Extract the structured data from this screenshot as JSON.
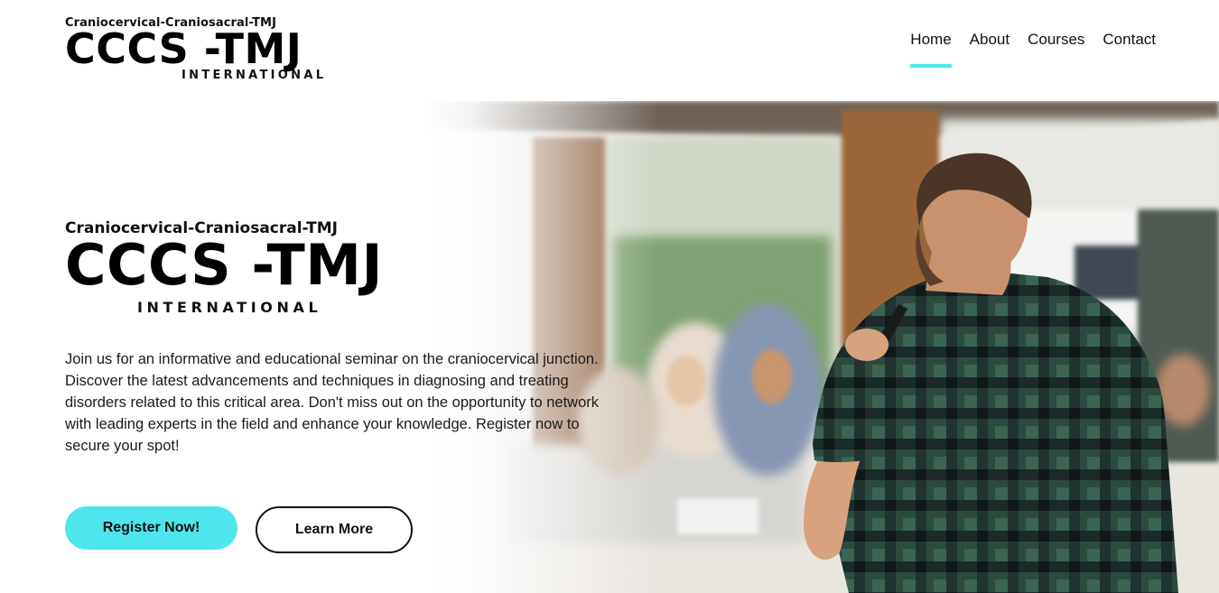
{
  "logo": {
    "subtitle": "Craniocervical-Craniosacral-TMJ",
    "title": "CCCS -TMJ",
    "tagline": "INTERNATIONAL"
  },
  "nav": {
    "items": [
      {
        "label": "Home",
        "active": true
      },
      {
        "label": "About",
        "active": false
      },
      {
        "label": "Courses",
        "active": false
      },
      {
        "label": "Contact",
        "active": false
      }
    ]
  },
  "hero": {
    "subtitle": "Craniocervical-Craniosacral-TMJ",
    "title": "CCCS -TMJ",
    "tagline": "INTERNATIONAL",
    "description": "Join us for an informative and educational seminar on the craniocervical junction. Discover the latest advancements and techniques in diagnosing and treating disorders related to this critical area. Don't miss out on the opportunity to network with leading experts in the field and enhance your knowledge. Register now to secure your spot!",
    "primary_button": "Register Now!",
    "secondary_button": "Learn More"
  },
  "colors": {
    "accent": "#4ee6ee",
    "text": "#111111",
    "background": "#ffffff"
  }
}
